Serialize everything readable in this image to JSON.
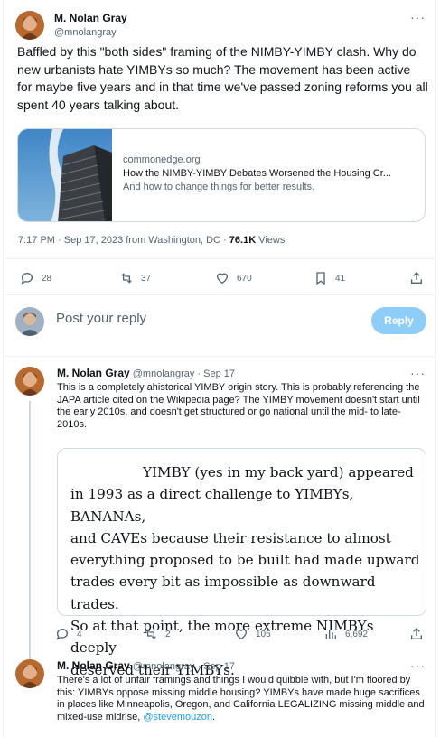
{
  "main_tweet": {
    "author_name": "M. Nolan Gray",
    "handle": "@mnolangray",
    "text": "Baffled by this \"both sides\" framing of the NIMBY-YIMBY clash. Why do new urbanists hate YIMBYs so much? The movement has been active for maybe five years and in that time we've passed zoning reforms you all spent 40 years talking about.",
    "card": {
      "domain": "commonedge.org",
      "title": "How the NIMBY-YIMBY Debates Worsened the Housing Cr...",
      "description": "And how to change things for better results."
    },
    "timestamp": "7:17 PM · Sep 17, 2023 from Washington, DC",
    "views_count": "76.1K",
    "views_label": "Views",
    "stats": {
      "replies": "28",
      "retweets": "37",
      "likes": "670",
      "bookmarks": "41"
    }
  },
  "reply_box": {
    "placeholder": "Post your reply",
    "button_label": "Reply"
  },
  "replies": [
    {
      "author_name": "M. Nolan Gray",
      "handle_date": "@mnolangray · Sep 17",
      "text": "This is a completely ahistorical YIMBY origin story. This is probably referencing the JAPA article cited on the Wikipedia page? The YIMBY movement doesn't start until the early 2010s, and doesn't get structured or go national until the mid- to late-2010s.",
      "quote_lines": [
        "YIMBY (yes in my back yard) appeared",
        "in 1993 as a direct challenge to YIMBYs, BANANAs,",
        "and CAVEs because their resistance to almost",
        "everything proposed to be built had made upward",
        "trades every bit as impossible as downward trades.",
        "So at that point, the more extreme NIMBYs deeply",
        "deserved their YIMBYs."
      ],
      "stats": {
        "replies": "4",
        "retweets": "2",
        "likes": "105",
        "views": "6,692"
      }
    },
    {
      "author_name": "M. Nolan Gray",
      "handle_date": "@mnolangray · Sep 17",
      "text": "There's a lot of unfair framings and things I would quibble with, but I'm floored by this: YIMBYs oppose missing middle housing? YIMBYs have made huge sacrifices in places like Minneapolis, Oregon, and California LEGALIZING missing middle and mixed-use midrise,",
      "mention": "@stevemouzon",
      "text_end": "."
    }
  ]
}
